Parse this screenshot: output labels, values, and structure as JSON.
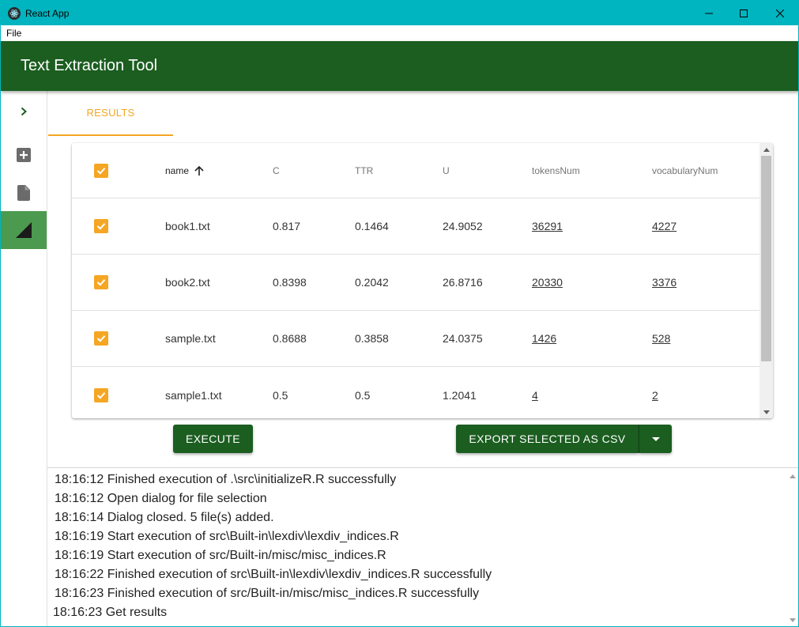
{
  "window": {
    "title": "React App",
    "menu": {
      "file": "File"
    }
  },
  "appbar": {
    "title": "Text Extraction Tool"
  },
  "sidebar": {
    "items": [
      {
        "name": "expand",
        "icon": "chevron-right-icon"
      },
      {
        "name": "add",
        "icon": "add-box-icon"
      },
      {
        "name": "file",
        "icon": "file-icon"
      },
      {
        "name": "results",
        "icon": "signal-triangle-icon",
        "active": true
      }
    ]
  },
  "tabs": {
    "results": "RESULTS"
  },
  "table": {
    "headers": [
      "name",
      "C",
      "TTR",
      "U",
      "tokensNum",
      "vocabularyNum"
    ],
    "sorted_column": "name",
    "rows": [
      {
        "name": "book1.txt",
        "C": "0.817",
        "TTR": "0.1464",
        "U": "24.9052",
        "tokensNum": "36291",
        "vocabularyNum": "4227",
        "checked": true
      },
      {
        "name": "book2.txt",
        "C": "0.8398",
        "TTR": "0.2042",
        "U": "26.8716",
        "tokensNum": "20330",
        "vocabularyNum": "3376",
        "checked": true
      },
      {
        "name": "sample.txt",
        "C": "0.8688",
        "TTR": "0.3858",
        "U": "24.0375",
        "tokensNum": "1426",
        "vocabularyNum": "528",
        "checked": true
      },
      {
        "name": "sample1.txt",
        "C": "0.5",
        "TTR": "0.5",
        "U": "1.2041",
        "tokensNum": "4",
        "vocabularyNum": "2",
        "checked": true
      }
    ]
  },
  "buttons": {
    "execute": "EXECUTE",
    "export": "EXPORT SELECTED AS CSV"
  },
  "log": [
    "18:16:12 Finished execution of .\\src\\initializeR.R successfully",
    "18:16:12 Open dialog for file selection",
    "18:16:14 Dialog closed. 5 file(s) added.",
    "18:16:19 Start execution of src\\Built-in\\lexdiv\\lexdiv_indices.R",
    "18:16:19 Start execution of src/Built-in/misc/misc_indices.R",
    "18:16:22 Finished execution of src\\Built-in\\lexdiv\\lexdiv_indices.R successfully",
    "18:16:23 Finished execution of src/Built-in/misc/misc_indices.R successfully",
    "18:16:23 Get results"
  ],
  "colors": {
    "titlebar": "#00b4c0",
    "appbar": "#1b5e20",
    "accent": "#f5a623",
    "sidebar_active": "#4c9a4f"
  }
}
